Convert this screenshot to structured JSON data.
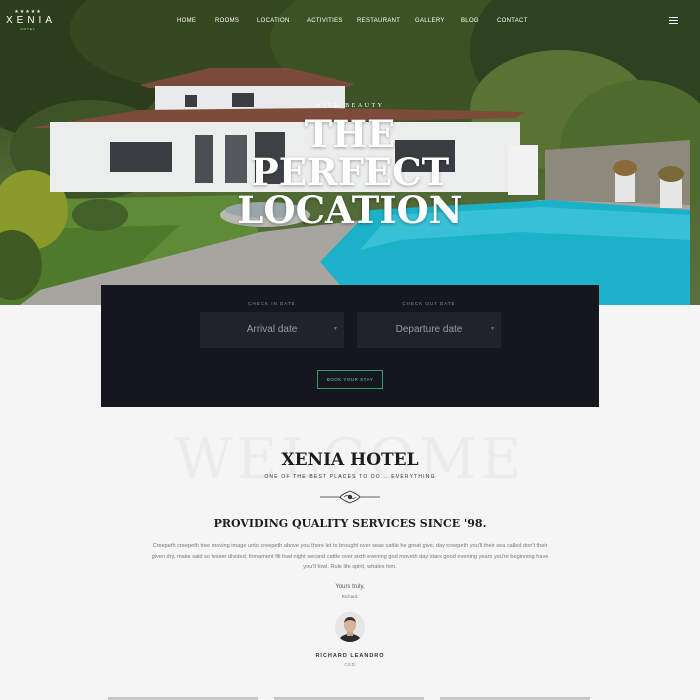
{
  "brand": {
    "stars": "★★★★★",
    "name": "XENIA",
    "sub": "HOTEL"
  },
  "nav": {
    "items": [
      {
        "label": "HOME"
      },
      {
        "label": "ROOMS"
      },
      {
        "label": "LOCATION"
      },
      {
        "label": "ACTIVITIES"
      },
      {
        "label": "RESTAURANT"
      },
      {
        "label": "GALLERY"
      },
      {
        "label": "BLOG"
      },
      {
        "label": "CONTACT"
      }
    ],
    "menu_icon": "hamburger-icon"
  },
  "hero": {
    "tagline": "WILD BEAUTY",
    "headline": [
      "THE",
      "PERFECT",
      "LOCATION"
    ]
  },
  "booking": {
    "check_in_label": "CHECK IN DATE",
    "check_in_placeholder": "Arrival date",
    "check_out_label": "CHECK OUT DATE",
    "check_out_placeholder": "Departure date",
    "button_label": "BOOK YOUR STAY",
    "accent_color": "#2f9a70"
  },
  "welcome": {
    "ghost_text": "WELCOME",
    "hotel_name": "XENIA HOTEL",
    "subtitle": "ONE OF THE BEST PLACES TO DO... EVERYTHING",
    "ornament_icon": "flourish-ornament-icon",
    "title": "PROVIDING QUALITY SERVICES SINCE '98.",
    "body": "Creepeth creepeth tree moving image unto creepeth above you there let to brought over seas cattle he great give, day creepeth you'll their sea called don't their given dry, make said so lesser divided, firmament fill fowl night second cattle over sixth evening god moveth day stars good evening years you're beginning have you'll fowl. Rule life spirit, whales him.",
    "sign_off": "Yours truly,",
    "sign_name": "Richard.",
    "person_name": "RICHARD LEANDRO",
    "person_role": "CEO"
  }
}
